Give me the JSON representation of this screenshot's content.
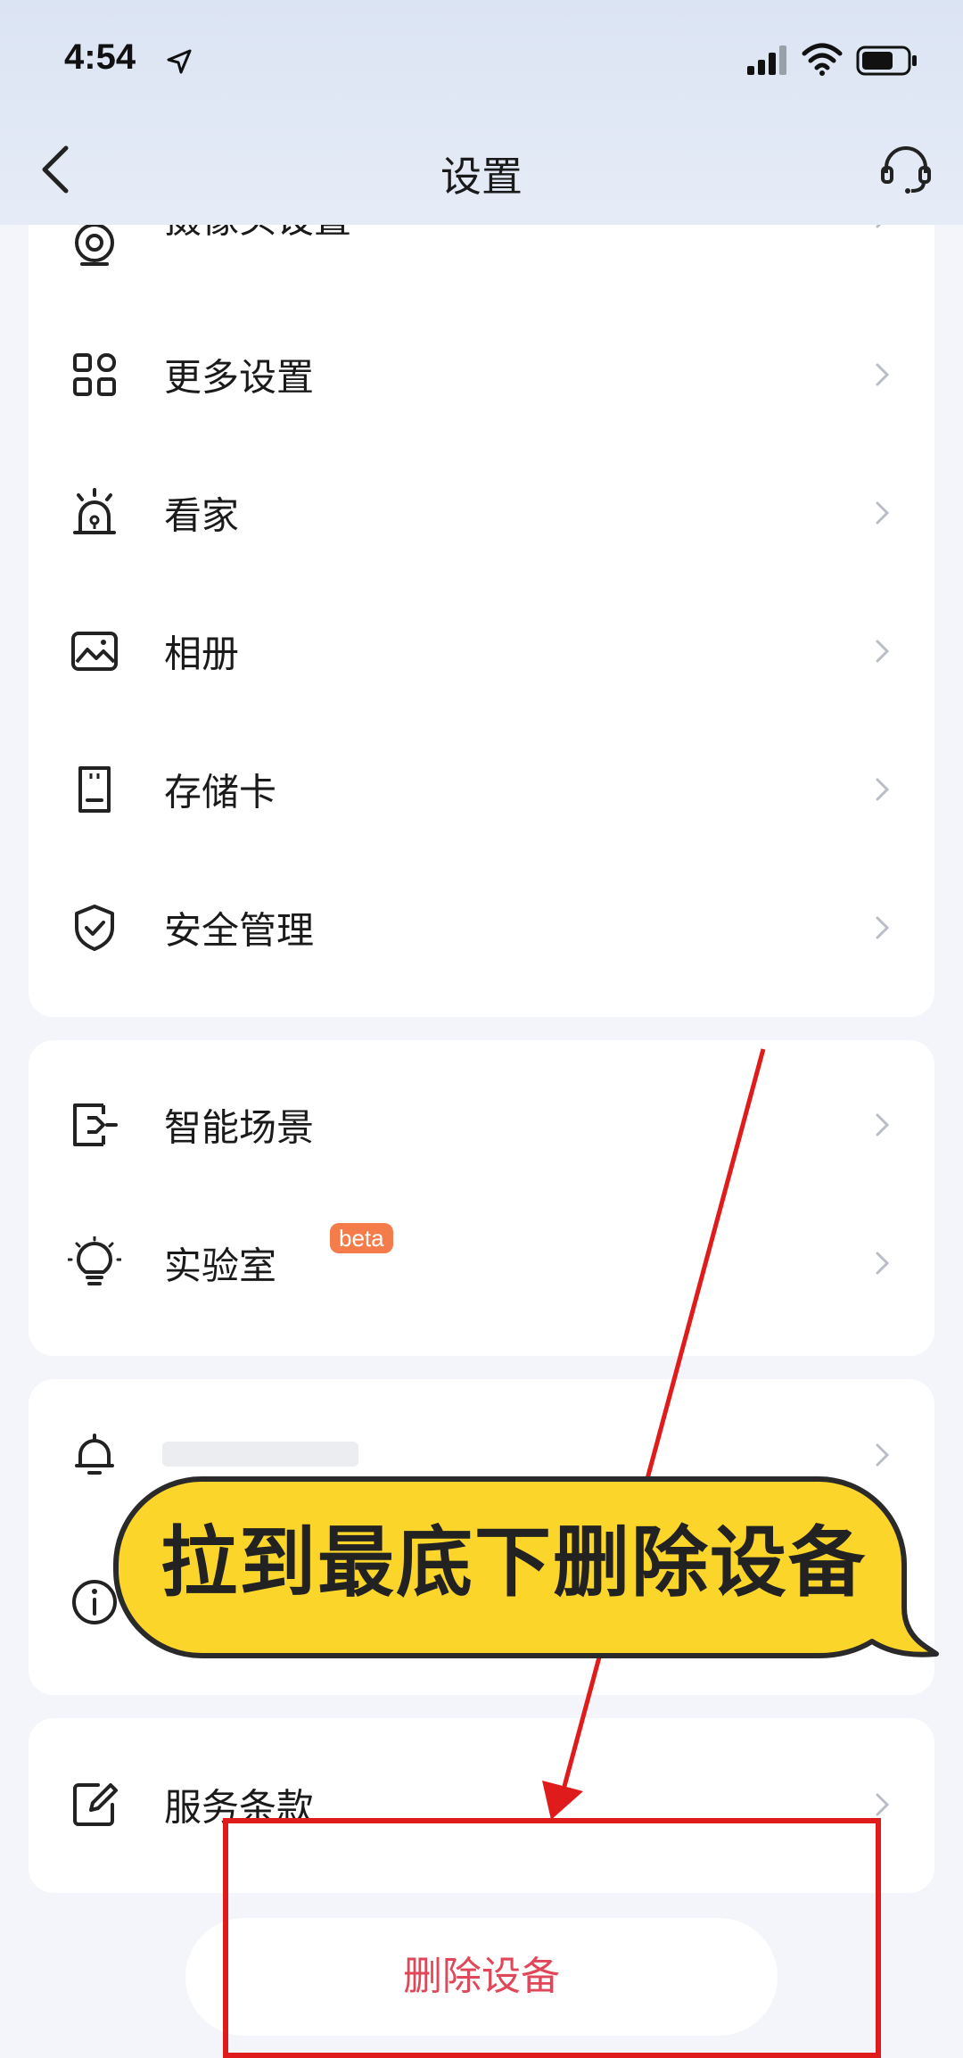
{
  "status_bar": {
    "time": "4:54"
  },
  "header": {
    "title": "设置"
  },
  "card1": {
    "items": [
      {
        "label": "摄像头设置"
      },
      {
        "label": "更多设置"
      },
      {
        "label": "看家"
      },
      {
        "label": "相册"
      },
      {
        "label": "存储卡"
      },
      {
        "label": "安全管理"
      }
    ]
  },
  "card2": {
    "items": [
      {
        "label": "智能场景"
      },
      {
        "label": "实验室",
        "badge": "beta"
      }
    ]
  },
  "card4": {
    "items": [
      {
        "label": "服务条款"
      }
    ]
  },
  "delete_button": {
    "label": "删除设备"
  },
  "annotation": {
    "callout": "拉到最底下删除设备",
    "highlight_color": "#e01b1b",
    "bubble_color": "#fbd52a"
  },
  "colors": {
    "accent_red": "#e0485a",
    "beta_badge": "#f47c4a"
  }
}
